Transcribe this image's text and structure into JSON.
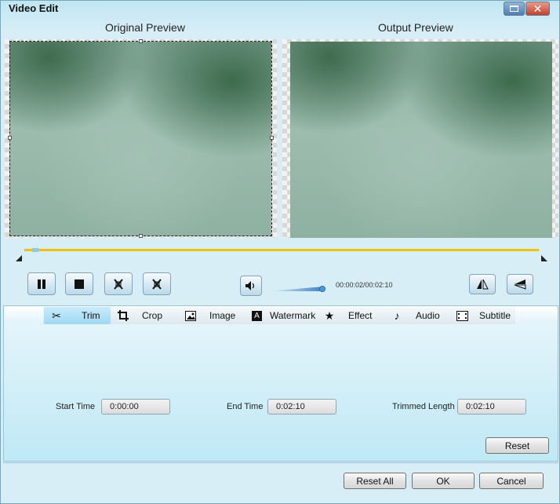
{
  "window": {
    "title": "Video Edit"
  },
  "preview": {
    "original_label": "Original Preview",
    "output_label": "Output Preview"
  },
  "player": {
    "time": "00:00:02/00:02:10",
    "playback_position_fraction": 0.015,
    "volume_fraction": 0.95
  },
  "tabs": [
    {
      "label": "Trim",
      "icon": "scissors-icon",
      "active": true
    },
    {
      "label": "Crop",
      "icon": "crop-icon",
      "active": false
    },
    {
      "label": "Image",
      "icon": "image-icon",
      "active": false
    },
    {
      "label": "Watermark",
      "icon": "watermark-icon",
      "active": false
    },
    {
      "label": "Effect",
      "icon": "star-icon",
      "active": false
    },
    {
      "label": "Audio",
      "icon": "music-note-icon",
      "active": false
    },
    {
      "label": "Subtitle",
      "icon": "subtitle-icon",
      "active": false
    }
  ],
  "trim": {
    "start_label": "Start Time",
    "start_value": "0:00:00",
    "end_label": "End Time",
    "end_value": "0:02:10",
    "length_label": "Trimmed Length",
    "length_value": "0:02:10",
    "reset_label": "Reset"
  },
  "footer": {
    "reset_all": "Reset All",
    "ok": "OK",
    "cancel": "Cancel"
  },
  "colors": {
    "timeline": "#f2c200",
    "accent": "#3b82c6",
    "panel": "#bfe9f6"
  }
}
